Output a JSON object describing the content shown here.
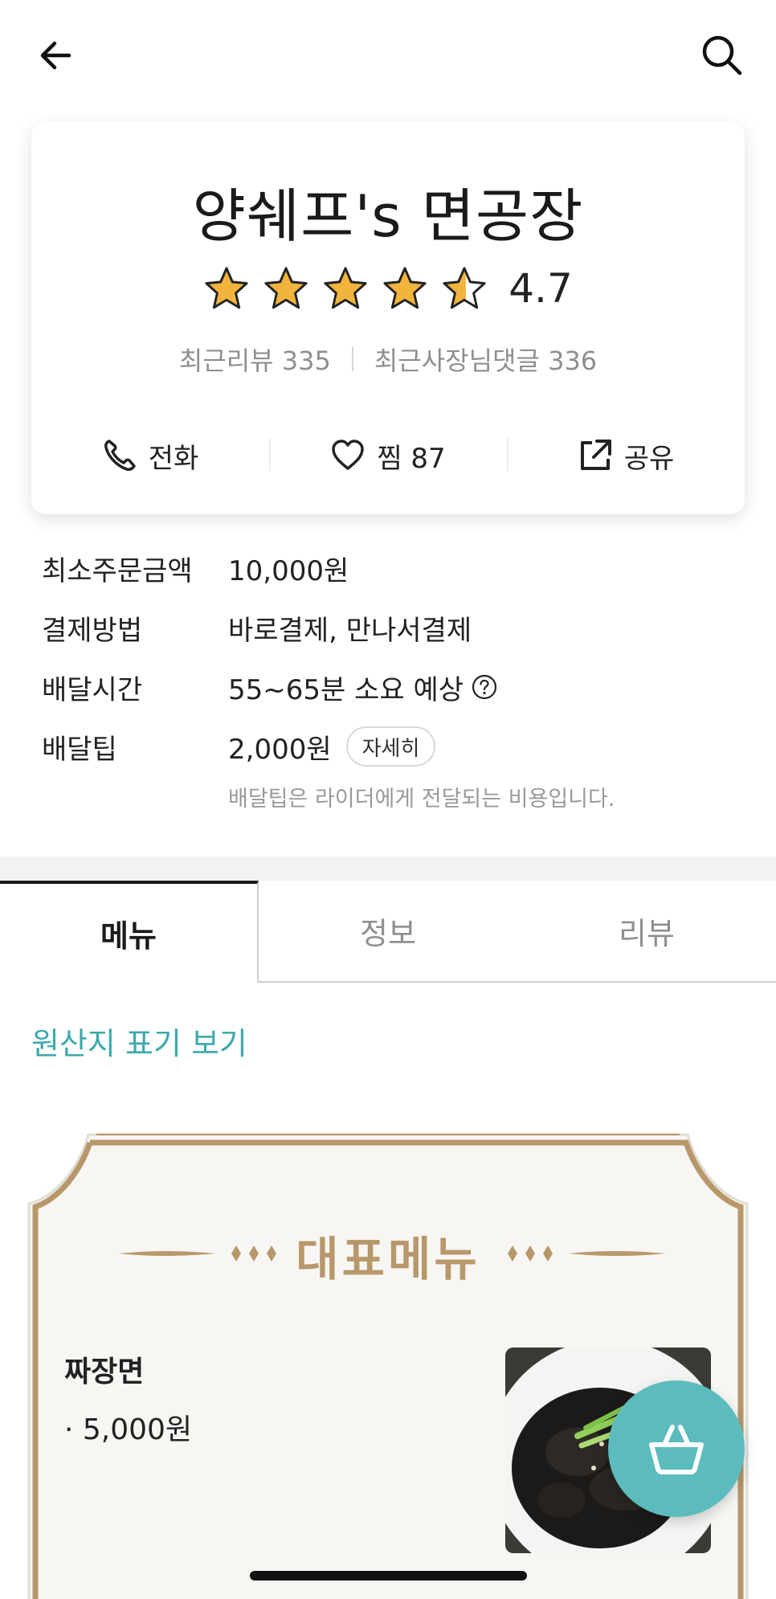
{
  "header": {
    "back_icon": "arrow-left-icon",
    "search_icon": "search-icon"
  },
  "store": {
    "name": "양쉐프's 면공장",
    "rating": "4.7",
    "stars": {
      "filled": 4,
      "half": 1,
      "total": 5,
      "color": "#f2b43c"
    },
    "recent_reviews": "최근리뷰 335",
    "owner_replies": "최근사장님댓글 336",
    "actions": [
      {
        "icon": "phone-icon",
        "label": "전화"
      },
      {
        "icon": "heart-icon",
        "label": "찜 87"
      },
      {
        "icon": "share-icon",
        "label": "공유"
      }
    ]
  },
  "info": {
    "min_order_label": "최소주문금액",
    "min_order_value": "10,000원",
    "payment_label": "결제방법",
    "payment_value": "바로결제, 만나서결제",
    "delivery_time_label": "배달시간",
    "delivery_time_value": "55~65분 소요 예상",
    "tip_label": "배달팁",
    "tip_value": "2,000원",
    "tip_detail_button": "자세히",
    "tip_note": "배달팁은 라이더에게 전달되는 비용입니다."
  },
  "tabs": [
    {
      "label": "메뉴",
      "active": true
    },
    {
      "label": "정보",
      "active": false
    },
    {
      "label": "리뷰",
      "active": false
    }
  ],
  "origin_link": "원산지 표기 보기",
  "featured": {
    "title": "대표메뉴",
    "accent_color": "#b8976b",
    "items": [
      {
        "name": "짜장면",
        "price": "· 5,000원"
      }
    ]
  },
  "cart": {
    "icon": "basket-icon",
    "color": "#5cbcbd"
  }
}
